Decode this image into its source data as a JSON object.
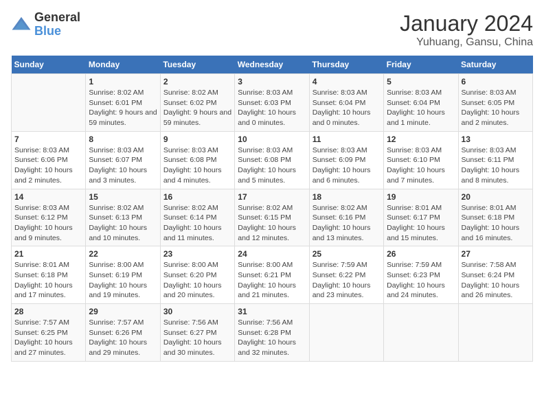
{
  "logo": {
    "text_general": "General",
    "text_blue": "Blue"
  },
  "title": "January 2024",
  "subtitle": "Yuhuang, Gansu, China",
  "days_of_week": [
    "Sunday",
    "Monday",
    "Tuesday",
    "Wednesday",
    "Thursday",
    "Friday",
    "Saturday"
  ],
  "weeks": [
    [
      {
        "day": "",
        "sunrise": "",
        "sunset": "",
        "daylight": ""
      },
      {
        "day": "1",
        "sunrise": "Sunrise: 8:02 AM",
        "sunset": "Sunset: 6:01 PM",
        "daylight": "Daylight: 9 hours and 59 minutes."
      },
      {
        "day": "2",
        "sunrise": "Sunrise: 8:02 AM",
        "sunset": "Sunset: 6:02 PM",
        "daylight": "Daylight: 9 hours and 59 minutes."
      },
      {
        "day": "3",
        "sunrise": "Sunrise: 8:03 AM",
        "sunset": "Sunset: 6:03 PM",
        "daylight": "Daylight: 10 hours and 0 minutes."
      },
      {
        "day": "4",
        "sunrise": "Sunrise: 8:03 AM",
        "sunset": "Sunset: 6:04 PM",
        "daylight": "Daylight: 10 hours and 0 minutes."
      },
      {
        "day": "5",
        "sunrise": "Sunrise: 8:03 AM",
        "sunset": "Sunset: 6:04 PM",
        "daylight": "Daylight: 10 hours and 1 minute."
      },
      {
        "day": "6",
        "sunrise": "Sunrise: 8:03 AM",
        "sunset": "Sunset: 6:05 PM",
        "daylight": "Daylight: 10 hours and 2 minutes."
      }
    ],
    [
      {
        "day": "7",
        "sunrise": "Sunrise: 8:03 AM",
        "sunset": "Sunset: 6:06 PM",
        "daylight": "Daylight: 10 hours and 2 minutes."
      },
      {
        "day": "8",
        "sunrise": "Sunrise: 8:03 AM",
        "sunset": "Sunset: 6:07 PM",
        "daylight": "Daylight: 10 hours and 3 minutes."
      },
      {
        "day": "9",
        "sunrise": "Sunrise: 8:03 AM",
        "sunset": "Sunset: 6:08 PM",
        "daylight": "Daylight: 10 hours and 4 minutes."
      },
      {
        "day": "10",
        "sunrise": "Sunrise: 8:03 AM",
        "sunset": "Sunset: 6:08 PM",
        "daylight": "Daylight: 10 hours and 5 minutes."
      },
      {
        "day": "11",
        "sunrise": "Sunrise: 8:03 AM",
        "sunset": "Sunset: 6:09 PM",
        "daylight": "Daylight: 10 hours and 6 minutes."
      },
      {
        "day": "12",
        "sunrise": "Sunrise: 8:03 AM",
        "sunset": "Sunset: 6:10 PM",
        "daylight": "Daylight: 10 hours and 7 minutes."
      },
      {
        "day": "13",
        "sunrise": "Sunrise: 8:03 AM",
        "sunset": "Sunset: 6:11 PM",
        "daylight": "Daylight: 10 hours and 8 minutes."
      }
    ],
    [
      {
        "day": "14",
        "sunrise": "Sunrise: 8:03 AM",
        "sunset": "Sunset: 6:12 PM",
        "daylight": "Daylight: 10 hours and 9 minutes."
      },
      {
        "day": "15",
        "sunrise": "Sunrise: 8:02 AM",
        "sunset": "Sunset: 6:13 PM",
        "daylight": "Daylight: 10 hours and 10 minutes."
      },
      {
        "day": "16",
        "sunrise": "Sunrise: 8:02 AM",
        "sunset": "Sunset: 6:14 PM",
        "daylight": "Daylight: 10 hours and 11 minutes."
      },
      {
        "day": "17",
        "sunrise": "Sunrise: 8:02 AM",
        "sunset": "Sunset: 6:15 PM",
        "daylight": "Daylight: 10 hours and 12 minutes."
      },
      {
        "day": "18",
        "sunrise": "Sunrise: 8:02 AM",
        "sunset": "Sunset: 6:16 PM",
        "daylight": "Daylight: 10 hours and 13 minutes."
      },
      {
        "day": "19",
        "sunrise": "Sunrise: 8:01 AM",
        "sunset": "Sunset: 6:17 PM",
        "daylight": "Daylight: 10 hours and 15 minutes."
      },
      {
        "day": "20",
        "sunrise": "Sunrise: 8:01 AM",
        "sunset": "Sunset: 6:18 PM",
        "daylight": "Daylight: 10 hours and 16 minutes."
      }
    ],
    [
      {
        "day": "21",
        "sunrise": "Sunrise: 8:01 AM",
        "sunset": "Sunset: 6:18 PM",
        "daylight": "Daylight: 10 hours and 17 minutes."
      },
      {
        "day": "22",
        "sunrise": "Sunrise: 8:00 AM",
        "sunset": "Sunset: 6:19 PM",
        "daylight": "Daylight: 10 hours and 19 minutes."
      },
      {
        "day": "23",
        "sunrise": "Sunrise: 8:00 AM",
        "sunset": "Sunset: 6:20 PM",
        "daylight": "Daylight: 10 hours and 20 minutes."
      },
      {
        "day": "24",
        "sunrise": "Sunrise: 8:00 AM",
        "sunset": "Sunset: 6:21 PM",
        "daylight": "Daylight: 10 hours and 21 minutes."
      },
      {
        "day": "25",
        "sunrise": "Sunrise: 7:59 AM",
        "sunset": "Sunset: 6:22 PM",
        "daylight": "Daylight: 10 hours and 23 minutes."
      },
      {
        "day": "26",
        "sunrise": "Sunrise: 7:59 AM",
        "sunset": "Sunset: 6:23 PM",
        "daylight": "Daylight: 10 hours and 24 minutes."
      },
      {
        "day": "27",
        "sunrise": "Sunrise: 7:58 AM",
        "sunset": "Sunset: 6:24 PM",
        "daylight": "Daylight: 10 hours and 26 minutes."
      }
    ],
    [
      {
        "day": "28",
        "sunrise": "Sunrise: 7:57 AM",
        "sunset": "Sunset: 6:25 PM",
        "daylight": "Daylight: 10 hours and 27 minutes."
      },
      {
        "day": "29",
        "sunrise": "Sunrise: 7:57 AM",
        "sunset": "Sunset: 6:26 PM",
        "daylight": "Daylight: 10 hours and 29 minutes."
      },
      {
        "day": "30",
        "sunrise": "Sunrise: 7:56 AM",
        "sunset": "Sunset: 6:27 PM",
        "daylight": "Daylight: 10 hours and 30 minutes."
      },
      {
        "day": "31",
        "sunrise": "Sunrise: 7:56 AM",
        "sunset": "Sunset: 6:28 PM",
        "daylight": "Daylight: 10 hours and 32 minutes."
      },
      {
        "day": "",
        "sunrise": "",
        "sunset": "",
        "daylight": ""
      },
      {
        "day": "",
        "sunrise": "",
        "sunset": "",
        "daylight": ""
      },
      {
        "day": "",
        "sunrise": "",
        "sunset": "",
        "daylight": ""
      }
    ]
  ]
}
